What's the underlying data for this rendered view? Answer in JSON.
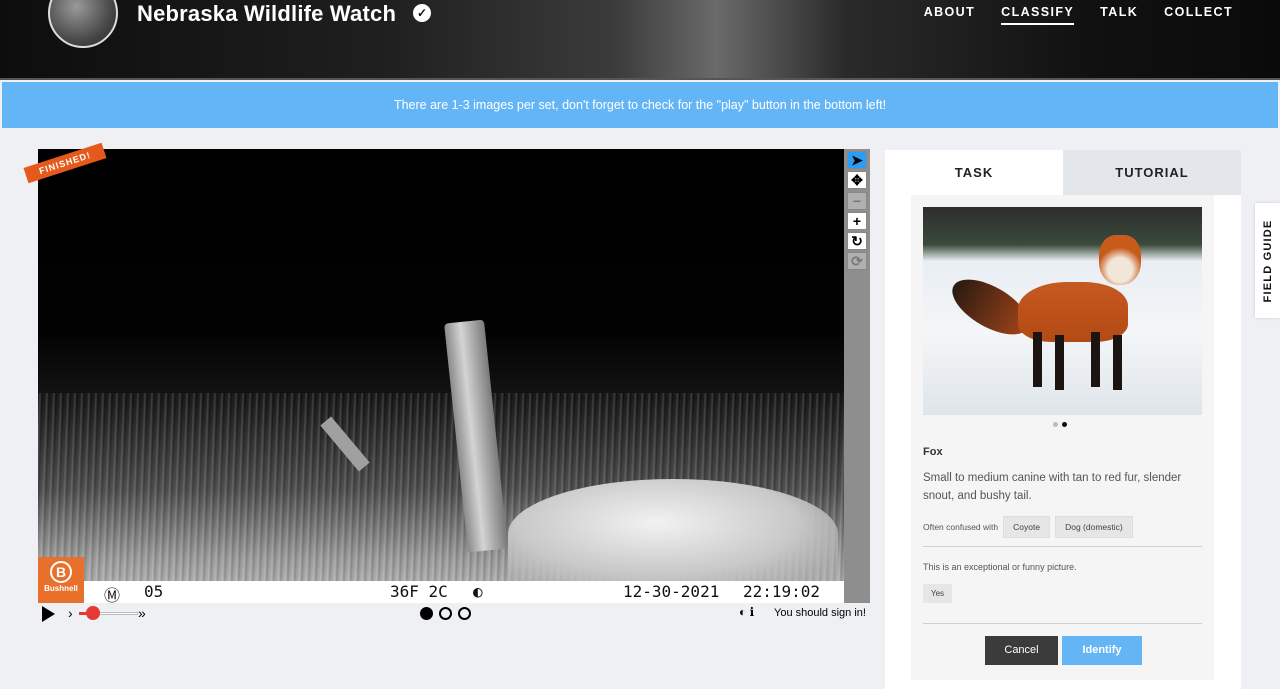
{
  "header": {
    "project_title": "Nebraska Wildlife Watch",
    "verified_icon": "check-circle-icon",
    "nav": [
      "ABOUT",
      "CLASSIFY",
      "TALK",
      "COLLECT"
    ],
    "active_nav": "CLASSIFY"
  },
  "banner": {
    "text": "There are 1-3 images per set, don't forget to check for the \"play\" button in the bottom left!"
  },
  "viewer": {
    "badge": "FINISHED!",
    "camera_strip": {
      "mode": "Ⓜ",
      "number": "05",
      "temperature": "36F 2C",
      "moon": "◐",
      "date": "12-30-2021",
      "time": "22:19:02"
    },
    "brand_logo": "Bushnell",
    "toolbar_icons": [
      "pointer-icon",
      "move-icon",
      "zoom-out-icon",
      "zoom-in-icon",
      "rotate-icon",
      "reset-icon"
    ],
    "frames": {
      "count": 3,
      "current": 1
    },
    "speed_slow": "›",
    "speed_fast": "»",
    "signin_text": "You should sign in!"
  },
  "panel": {
    "tabs": [
      "TASK",
      "TUTORIAL"
    ],
    "image_pager": {
      "count": 2,
      "current": 2
    },
    "species_name": "Fox",
    "description": "Small to medium canine with tan to red fur, slender snout, and bushy tail.",
    "confused_label": "Often confused with",
    "confused_with": [
      "Coyote",
      "Dog (domestic)"
    ],
    "question": "This is an exceptional or funny picture.",
    "answer": "Yes",
    "cancel_label": "Cancel",
    "identify_label": "Identify"
  },
  "field_guide_label": "FIELD GUIDE",
  "colors": {
    "banner": "#64b5f6",
    "badge": "#e55a1c",
    "slider": "#e53935",
    "identify": "#64b5f6",
    "cancel": "#3b3b3b"
  }
}
